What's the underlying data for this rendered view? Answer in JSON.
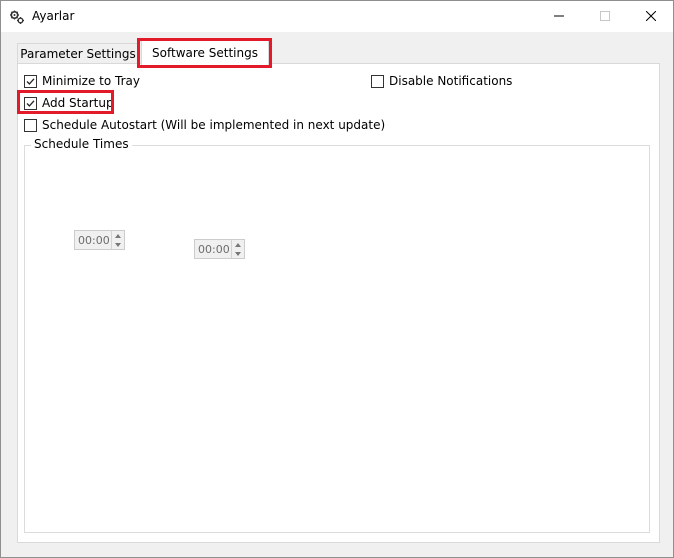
{
  "window": {
    "title": "Ayarlar",
    "icon": "gears-icon",
    "controls": [
      "minimize-icon",
      "maximize-icon",
      "close-icon"
    ]
  },
  "tabs": [
    {
      "label": "Parameter Settings",
      "selected": false
    },
    {
      "label": "Software Settings",
      "selected": true
    }
  ],
  "options": {
    "minimize_to_tray": {
      "label": "Minimize to Tray",
      "checked": true
    },
    "disable_notifications": {
      "label": "Disable Notifications",
      "checked": false
    },
    "add_startup": {
      "label": "Add Startup",
      "checked": true
    },
    "schedule_autostart": {
      "label": "Schedule Autostart (Will be implemented in next update)",
      "checked": false
    }
  },
  "schedule": {
    "title": "Schedule Times",
    "times": [
      {
        "value": "00:00",
        "enabled": false
      },
      {
        "value": "00:00",
        "enabled": false
      }
    ]
  },
  "colors": {
    "highlight": "#e31a2a",
    "window_bg": "#f0f0f0",
    "panel_bg": "#ffffff"
  }
}
